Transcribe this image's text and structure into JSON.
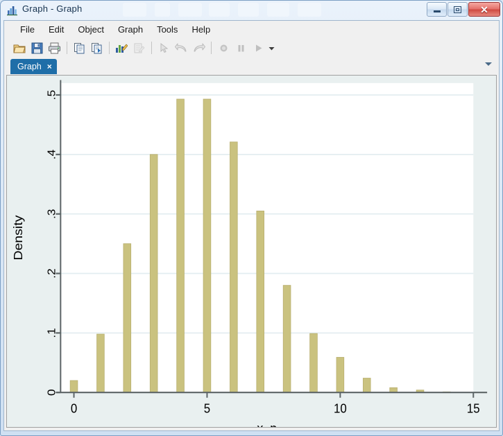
{
  "window": {
    "title": "Graph - Graph",
    "icon": "bar-chart-icon",
    "controls": {
      "minimize": "Minimize",
      "maximize": "Maximize",
      "close": "Close"
    }
  },
  "menu": {
    "items": [
      {
        "label": "File"
      },
      {
        "label": "Edit"
      },
      {
        "label": "Object"
      },
      {
        "label": "Graph"
      },
      {
        "label": "Tools"
      },
      {
        "label": "Help"
      }
    ]
  },
  "toolbar": {
    "buttons": [
      {
        "name": "open-icon",
        "tooltip": "Open",
        "enabled": true
      },
      {
        "name": "save-icon",
        "tooltip": "Save",
        "enabled": true
      },
      {
        "name": "print-icon",
        "tooltip": "Print",
        "enabled": true
      },
      {
        "name": "copy-icon",
        "tooltip": "Copy",
        "enabled": true
      },
      {
        "name": "paste-icon",
        "tooltip": "Paste",
        "enabled": true
      },
      {
        "name": "graph-editor-icon",
        "tooltip": "Start Graph Editor",
        "enabled": true
      },
      {
        "name": "grid-edit-icon",
        "tooltip": "Grid edit",
        "enabled": false
      },
      {
        "name": "pointer-icon",
        "tooltip": "Pointer tool",
        "enabled": false
      },
      {
        "name": "undo-icon",
        "tooltip": "Undo",
        "enabled": false
      },
      {
        "name": "redo-icon",
        "tooltip": "Redo",
        "enabled": false
      },
      {
        "name": "record-icon",
        "tooltip": "Record",
        "enabled": false
      },
      {
        "name": "pause-icon",
        "tooltip": "Pause",
        "enabled": false
      },
      {
        "name": "play-icon",
        "tooltip": "Play",
        "enabled": false
      },
      {
        "name": "play-dropdown-icon",
        "tooltip": "Play options",
        "enabled": true
      }
    ]
  },
  "tabs": {
    "items": [
      {
        "label": "Graph",
        "active": true,
        "close_label": "×"
      }
    ],
    "dropdown": "tab-list-dropdown"
  },
  "colors": {
    "bar_fill": "#cac27f",
    "bar_edge": "#b9b070",
    "plot_background": "#ffffff",
    "graph_background": "#e9f0f0",
    "gridline": "#e3edf0",
    "axis": "#5c6466",
    "tab_active": "#1f6ea8",
    "title_text": "#16324f"
  },
  "chart_data": {
    "type": "bar",
    "title": "",
    "xlabel": "x_p",
    "ylabel": "Density",
    "xlim": [
      -0.5,
      15.0
    ],
    "ylim": [
      0,
      0.52
    ],
    "xticks": [
      0,
      5,
      10,
      15
    ],
    "xtick_labels": [
      "0",
      "5",
      "10",
      "15"
    ],
    "yticks": [
      0,
      0.1,
      0.2,
      0.3,
      0.4,
      0.5
    ],
    "ytick_labels": [
      "0",
      ".1",
      ".2",
      ".3",
      ".4",
      ".5"
    ],
    "grid": "horizontal",
    "legend": "none",
    "bar_width": 0.28,
    "categories": [
      0,
      1,
      2,
      3,
      4,
      5,
      6,
      7,
      8,
      9,
      10,
      11,
      12,
      13,
      14
    ],
    "values": [
      0.02,
      0.098,
      0.25,
      0.4,
      0.493,
      0.493,
      0.421,
      0.305,
      0.18,
      0.099,
      0.059,
      0.024,
      0.008,
      0.004,
      0.001
    ]
  }
}
